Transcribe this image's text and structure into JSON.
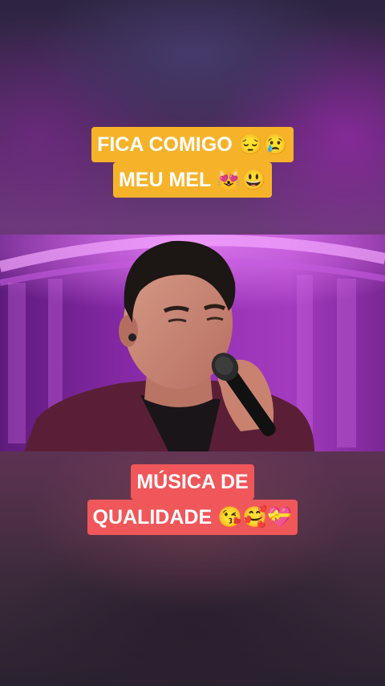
{
  "caption_top": {
    "line1": "FICA COMIGO 😔😢",
    "line2": "MEU MEL 😻😃",
    "background_color": "#f6b32a"
  },
  "caption_bottom": {
    "line1": "MÚSICA DE",
    "line2": "QUALIDADE 😘🥰💝",
    "background_color": "#f0575a"
  },
  "video": {
    "stage_color": "#9d35b8"
  }
}
